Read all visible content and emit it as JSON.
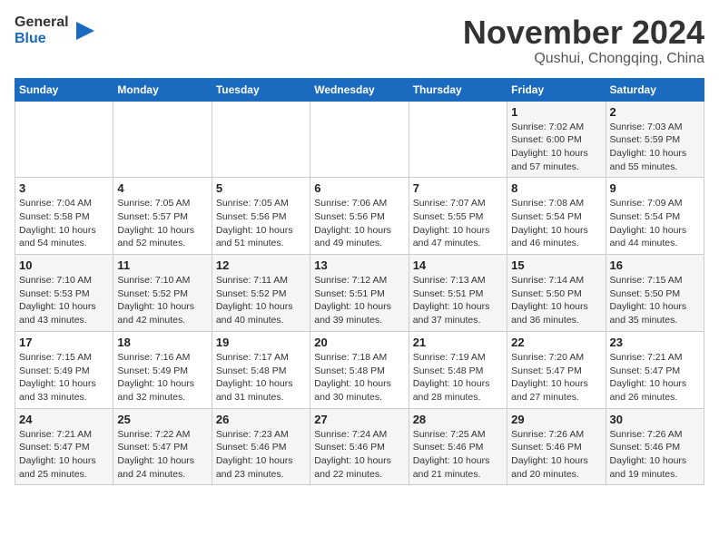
{
  "header": {
    "logo_line1": "General",
    "logo_line2": "Blue",
    "month": "November 2024",
    "location": "Qushui, Chongqing, China"
  },
  "weekdays": [
    "Sunday",
    "Monday",
    "Tuesday",
    "Wednesday",
    "Thursday",
    "Friday",
    "Saturday"
  ],
  "weeks": [
    [
      {
        "day": "",
        "info": ""
      },
      {
        "day": "",
        "info": ""
      },
      {
        "day": "",
        "info": ""
      },
      {
        "day": "",
        "info": ""
      },
      {
        "day": "",
        "info": ""
      },
      {
        "day": "1",
        "info": "Sunrise: 7:02 AM\nSunset: 6:00 PM\nDaylight: 10 hours and 57 minutes."
      },
      {
        "day": "2",
        "info": "Sunrise: 7:03 AM\nSunset: 5:59 PM\nDaylight: 10 hours and 55 minutes."
      }
    ],
    [
      {
        "day": "3",
        "info": "Sunrise: 7:04 AM\nSunset: 5:58 PM\nDaylight: 10 hours and 54 minutes."
      },
      {
        "day": "4",
        "info": "Sunrise: 7:05 AM\nSunset: 5:57 PM\nDaylight: 10 hours and 52 minutes."
      },
      {
        "day": "5",
        "info": "Sunrise: 7:05 AM\nSunset: 5:56 PM\nDaylight: 10 hours and 51 minutes."
      },
      {
        "day": "6",
        "info": "Sunrise: 7:06 AM\nSunset: 5:56 PM\nDaylight: 10 hours and 49 minutes."
      },
      {
        "day": "7",
        "info": "Sunrise: 7:07 AM\nSunset: 5:55 PM\nDaylight: 10 hours and 47 minutes."
      },
      {
        "day": "8",
        "info": "Sunrise: 7:08 AM\nSunset: 5:54 PM\nDaylight: 10 hours and 46 minutes."
      },
      {
        "day": "9",
        "info": "Sunrise: 7:09 AM\nSunset: 5:54 PM\nDaylight: 10 hours and 44 minutes."
      }
    ],
    [
      {
        "day": "10",
        "info": "Sunrise: 7:10 AM\nSunset: 5:53 PM\nDaylight: 10 hours and 43 minutes."
      },
      {
        "day": "11",
        "info": "Sunrise: 7:10 AM\nSunset: 5:52 PM\nDaylight: 10 hours and 42 minutes."
      },
      {
        "day": "12",
        "info": "Sunrise: 7:11 AM\nSunset: 5:52 PM\nDaylight: 10 hours and 40 minutes."
      },
      {
        "day": "13",
        "info": "Sunrise: 7:12 AM\nSunset: 5:51 PM\nDaylight: 10 hours and 39 minutes."
      },
      {
        "day": "14",
        "info": "Sunrise: 7:13 AM\nSunset: 5:51 PM\nDaylight: 10 hours and 37 minutes."
      },
      {
        "day": "15",
        "info": "Sunrise: 7:14 AM\nSunset: 5:50 PM\nDaylight: 10 hours and 36 minutes."
      },
      {
        "day": "16",
        "info": "Sunrise: 7:15 AM\nSunset: 5:50 PM\nDaylight: 10 hours and 35 minutes."
      }
    ],
    [
      {
        "day": "17",
        "info": "Sunrise: 7:15 AM\nSunset: 5:49 PM\nDaylight: 10 hours and 33 minutes."
      },
      {
        "day": "18",
        "info": "Sunrise: 7:16 AM\nSunset: 5:49 PM\nDaylight: 10 hours and 32 minutes."
      },
      {
        "day": "19",
        "info": "Sunrise: 7:17 AM\nSunset: 5:48 PM\nDaylight: 10 hours and 31 minutes."
      },
      {
        "day": "20",
        "info": "Sunrise: 7:18 AM\nSunset: 5:48 PM\nDaylight: 10 hours and 30 minutes."
      },
      {
        "day": "21",
        "info": "Sunrise: 7:19 AM\nSunset: 5:48 PM\nDaylight: 10 hours and 28 minutes."
      },
      {
        "day": "22",
        "info": "Sunrise: 7:20 AM\nSunset: 5:47 PM\nDaylight: 10 hours and 27 minutes."
      },
      {
        "day": "23",
        "info": "Sunrise: 7:21 AM\nSunset: 5:47 PM\nDaylight: 10 hours and 26 minutes."
      }
    ],
    [
      {
        "day": "24",
        "info": "Sunrise: 7:21 AM\nSunset: 5:47 PM\nDaylight: 10 hours and 25 minutes."
      },
      {
        "day": "25",
        "info": "Sunrise: 7:22 AM\nSunset: 5:47 PM\nDaylight: 10 hours and 24 minutes."
      },
      {
        "day": "26",
        "info": "Sunrise: 7:23 AM\nSunset: 5:46 PM\nDaylight: 10 hours and 23 minutes."
      },
      {
        "day": "27",
        "info": "Sunrise: 7:24 AM\nSunset: 5:46 PM\nDaylight: 10 hours and 22 minutes."
      },
      {
        "day": "28",
        "info": "Sunrise: 7:25 AM\nSunset: 5:46 PM\nDaylight: 10 hours and 21 minutes."
      },
      {
        "day": "29",
        "info": "Sunrise: 7:26 AM\nSunset: 5:46 PM\nDaylight: 10 hours and 20 minutes."
      },
      {
        "day": "30",
        "info": "Sunrise: 7:26 AM\nSunset: 5:46 PM\nDaylight: 10 hours and 19 minutes."
      }
    ]
  ]
}
